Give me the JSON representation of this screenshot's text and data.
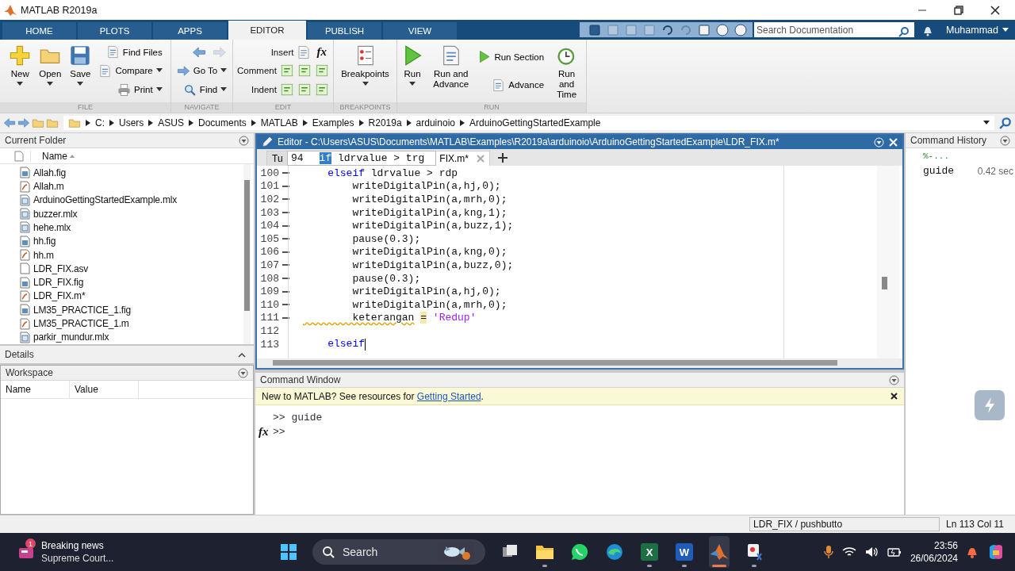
{
  "window": {
    "title": "MATLAB R2019a"
  },
  "tabs": [
    {
      "label": "HOME",
      "selected": false
    },
    {
      "label": "PLOTS",
      "selected": false
    },
    {
      "label": "APPS",
      "selected": false
    },
    {
      "label": "EDITOR",
      "selected": true
    },
    {
      "label": "PUBLISH",
      "selected": false
    },
    {
      "label": "VIEW",
      "selected": false
    }
  ],
  "quick_access": [
    {
      "disabled": false
    },
    {
      "disabled": true
    },
    {
      "disabled": true
    },
    {
      "disabled": true
    },
    {
      "disabled": false
    },
    {
      "disabled": true
    },
    {
      "disabled": false
    },
    {
      "disabled": false
    },
    {
      "disabled": false
    }
  ],
  "search": {
    "placeholder": "Search Documentation"
  },
  "user": {
    "name": "Muhammad"
  },
  "ribbon": [
    {
      "label": "FILE",
      "items": [
        {
          "kind": "big",
          "label": "New",
          "dropdown": true
        },
        {
          "kind": "big",
          "label": "Open",
          "dropdown": true
        },
        {
          "kind": "big",
          "label": "Save",
          "dropdown": true
        },
        {
          "kind": "small",
          "label": "Find Files",
          "dropdown": false
        },
        {
          "kind": "small",
          "label": "Compare",
          "dropdown": true
        },
        {
          "kind": "small",
          "label": "Print",
          "dropdown": true
        }
      ]
    },
    {
      "label": "NAVIGATE",
      "items": [
        {
          "kind": "icon",
          "disabled": false
        },
        {
          "kind": "icon",
          "disabled": true
        },
        {
          "kind": "small",
          "label": "Go To",
          "dropdown": true
        },
        {
          "kind": "small",
          "label": "Find",
          "dropdown": true
        }
      ]
    },
    {
      "label": "EDIT",
      "items": [
        {
          "kind": "row",
          "label": "Insert",
          "glyph": "fx"
        },
        {
          "kind": "row",
          "label": "Comment"
        },
        {
          "kind": "row",
          "label": "Indent"
        }
      ]
    },
    {
      "label": "BREAKPOINTS",
      "items": [
        {
          "kind": "big",
          "label": "Breakpoints",
          "dropdown": true
        }
      ]
    },
    {
      "label": "RUN",
      "items": [
        {
          "kind": "big",
          "label": "Run",
          "dropdown": true
        },
        {
          "kind": "big",
          "label": "Run and Advance",
          "dropdown": false
        },
        {
          "kind": "small",
          "label": "Run Section",
          "dropdown": false
        },
        {
          "kind": "small",
          "label": "Advance",
          "dropdown": false
        },
        {
          "kind": "big",
          "label": "Run and Time",
          "dropdown": false
        }
      ]
    }
  ],
  "address": {
    "path": [
      "C:",
      "Users",
      "ASUS",
      "Documents",
      "MATLAB",
      "Examples",
      "R2019a",
      "arduinoio",
      "ArduinoGettingStartedExample"
    ]
  },
  "current_folder": {
    "title": "Current Folder",
    "column": "Name",
    "files": [
      {
        "name": "Allah.fig",
        "kind": "fig"
      },
      {
        "name": "Allah.m",
        "kind": "m"
      },
      {
        "name": "ArduinoGettingStartedExample.mlx",
        "kind": "mlx"
      },
      {
        "name": "buzzer.mlx",
        "kind": "mlx"
      },
      {
        "name": "hehe.mlx",
        "kind": "mlx"
      },
      {
        "name": "hh.fig",
        "kind": "fig"
      },
      {
        "name": "hh.m",
        "kind": "m"
      },
      {
        "name": "LDR_FIX.asv",
        "kind": "asv"
      },
      {
        "name": "LDR_FIX.fig",
        "kind": "fig"
      },
      {
        "name": "LDR_FIX.m*",
        "kind": "m"
      },
      {
        "name": "LM35_PRACTICE_1.fig",
        "kind": "fig"
      },
      {
        "name": "LM35_PRACTICE_1.m",
        "kind": "m"
      },
      {
        "name": "parkir_mundur.mlx",
        "kind": "mlx"
      }
    ]
  },
  "details": {
    "title": "Details"
  },
  "workspace": {
    "title": "Workspace",
    "columns": [
      "Name",
      "Value"
    ]
  },
  "editor": {
    "title": "Editor - C:\\Users\\ASUS\\Documents\\MATLAB\\Examples\\R2019a\\arduinoio\\ArduinoGettingStartedExample\\LDR_FIX.m*",
    "tabs": [
      {
        "label": "Tu",
        "selected": false
      },
      {
        "label": "FIX.m*",
        "selected": true
      }
    ],
    "tooltip": {
      "line": "94",
      "parts": [
        {
          "kind": "match",
          "text": "if"
        },
        {
          "kind": "plain",
          "text": " ldrvalue > trg"
        }
      ]
    },
    "lines": [
      {
        "number": "100",
        "executable": true,
        "parts": [
          {
            "kind": "keyword",
            "text": "    elseif"
          },
          {
            "kind": "plain",
            "text": " ldrvalue > rdp"
          }
        ]
      },
      {
        "number": "101",
        "executable": true,
        "parts": [
          {
            "kind": "plain",
            "text": "        writeDigitalPin(a,hj,0);"
          }
        ]
      },
      {
        "number": "102",
        "executable": true,
        "parts": [
          {
            "kind": "plain",
            "text": "        writeDigitalPin(a,mrh,0);"
          }
        ]
      },
      {
        "number": "103",
        "executable": true,
        "parts": [
          {
            "kind": "plain",
            "text": "        writeDigitalPin(a,kng,1);"
          }
        ]
      },
      {
        "number": "104",
        "executable": true,
        "parts": [
          {
            "kind": "plain",
            "text": "        writeDigitalPin(a,buzz,1);"
          }
        ]
      },
      {
        "number": "105",
        "executable": true,
        "parts": [
          {
            "kind": "plain",
            "text": "        pause(0.3);"
          }
        ]
      },
      {
        "number": "106",
        "executable": true,
        "parts": [
          {
            "kind": "plain",
            "text": "        writeDigitalPin(a,kng,0);"
          }
        ]
      },
      {
        "number": "107",
        "executable": true,
        "parts": [
          {
            "kind": "plain",
            "text": "        writeDigitalPin(a,buzz,0);"
          }
        ]
      },
      {
        "number": "108",
        "executable": true,
        "parts": [
          {
            "kind": "plain",
            "text": "        pause(0.3);"
          }
        ]
      },
      {
        "number": "109",
        "executable": true,
        "parts": [
          {
            "kind": "plain",
            "text": "        writeDigitalPin(a,hj,0);"
          }
        ]
      },
      {
        "number": "110",
        "executable": true,
        "parts": [
          {
            "kind": "plain",
            "text": "        writeDigitalPin(a,mrh,0);"
          }
        ]
      },
      {
        "number": "111",
        "executable": true,
        "parts": [
          {
            "kind": "flagged",
            "text": "        keterangan"
          },
          {
            "kind": "warn",
            "text": "="
          },
          {
            "kind": "string",
            "text": "'Redup'"
          }
        ]
      },
      {
        "number": "112",
        "executable": false
      },
      {
        "number": "113",
        "executable": false,
        "parts": [
          {
            "kind": "keyword",
            "text": "    elseif"
          }
        ]
      }
    ]
  },
  "command_window": {
    "title": "Command Window",
    "banner": {
      "text": "New to MATLAB? See resources for ",
      "link": "Getting Started",
      "end": "."
    },
    "lines": [
      ">> guide",
      ">>"
    ],
    "glyph": "fx"
  },
  "command_history": {
    "title": "Command History",
    "entries": [
      {
        "kind": "separator",
        "text": "%-..."
      },
      {
        "kind": "command",
        "text": "guide",
        "time": "0.42 sec"
      }
    ]
  },
  "status_bar": {
    "function": "LDR_FIX / pushbutto",
    "position": "Ln 113 Col 11"
  },
  "taskbar": {
    "news": {
      "badge": "1",
      "title": "Breaking news",
      "subtitle": "Supreme Court..."
    },
    "search": {
      "placeholder": "Search"
    },
    "apps": [
      {
        "running": false,
        "active": false
      },
      {
        "running": true,
        "active": false
      },
      {
        "running": false,
        "active": false
      },
      {
        "running": false,
        "active": false
      },
      {
        "running": true,
        "active": false,
        "glyph": "X"
      },
      {
        "running": true,
        "active": false,
        "glyph": "W"
      },
      {
        "running": true,
        "active": true
      },
      {
        "running": true,
        "active": false
      }
    ],
    "clock": {
      "time": "23:56",
      "date": "26/06/2024"
    }
  }
}
